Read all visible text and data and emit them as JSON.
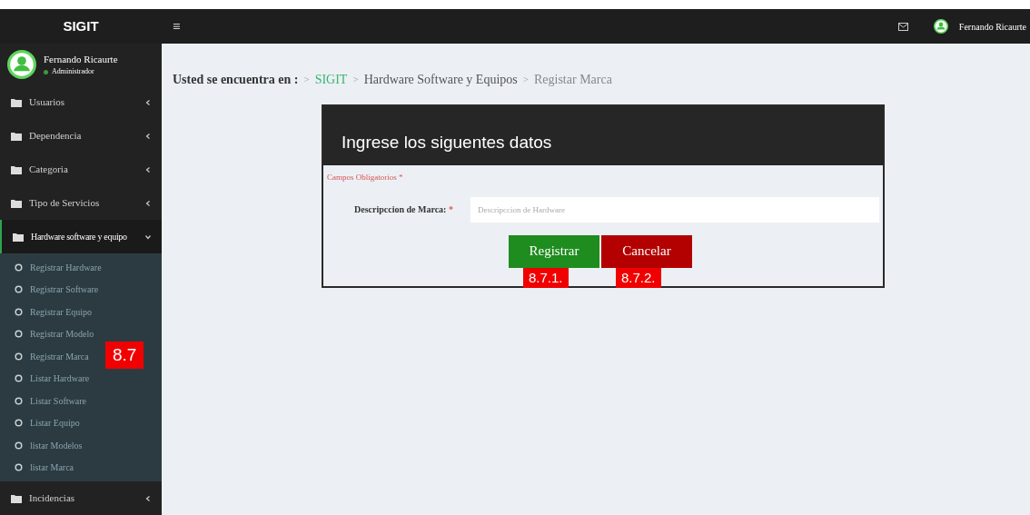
{
  "topbar": {
    "brand": "SIGIT",
    "menu_glyph": "≡",
    "user_name": "Fernando Ricaurte"
  },
  "sidebar": {
    "user": {
      "name": "Fernando Ricaurte",
      "role": "Administrador"
    },
    "items": [
      {
        "label": "Usuarios",
        "expanded": false
      },
      {
        "label": "Dependencia",
        "expanded": false
      },
      {
        "label": "Categoria",
        "expanded": false
      },
      {
        "label": "Tipo de Servicios",
        "expanded": false
      },
      {
        "label": "Hardware software y equipo",
        "expanded": true,
        "children": [
          {
            "label": "Registrar Hardware",
            "selected": false
          },
          {
            "label": "Registrar Software",
            "selected": false
          },
          {
            "label": "Registrar Equipo",
            "selected": false
          },
          {
            "label": "Registrar Modelo",
            "selected": false
          },
          {
            "label": "Registrar Marca",
            "selected": false,
            "annotation": "8.7"
          },
          {
            "label": "Listar Hardware",
            "selected": false
          },
          {
            "label": "Listar Software",
            "selected": false
          },
          {
            "label": "Listar Equipo",
            "selected": false
          },
          {
            "label": "listar Modelos",
            "selected": false
          },
          {
            "label": "listar Marca",
            "selected": false
          }
        ]
      },
      {
        "label": "Incidencias",
        "expanded": false
      }
    ]
  },
  "breadcrumb": {
    "prefix": "Usted se encuentra en :",
    "separator": ">",
    "items": [
      "SIGIT",
      "Hardware Software y Equipos",
      "Registar Marca"
    ]
  },
  "form": {
    "title": "Ingrese los siguentes datos",
    "required_note": "Campos Obligatorios *",
    "field": {
      "label": "Descripccion de Marca:",
      "required_mark": "*",
      "placeholder": "Descripccion de Hardware"
    },
    "buttons": [
      {
        "label": "Registrar",
        "kind": "primary",
        "annotation": "8.7.1."
      },
      {
        "label": "Cancelar",
        "kind": "danger",
        "annotation": "8.7.2."
      }
    ]
  }
}
